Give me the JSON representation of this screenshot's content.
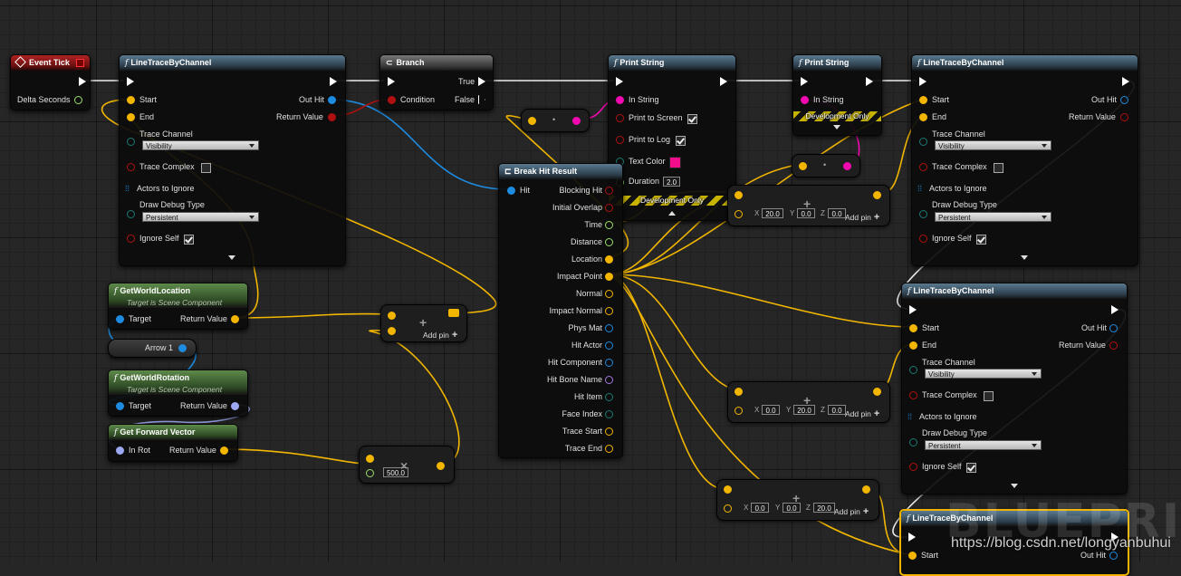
{
  "canvas": {
    "watermark": "BLUEPRINT",
    "url_overlay": "https://blog.csdn.net/longyanbuhui"
  },
  "colors": {
    "exec": "#ffffff",
    "float": "#f2b600",
    "vector": "#f2b600",
    "object": "#1d8be0",
    "string": "#f20ab0",
    "bool": "#b01010",
    "struct": "#1d8be0",
    "rotator": "#9ca8f0",
    "header_function": "#4a6a7f",
    "header_event": "#b02222",
    "header_pure": "#4a7a3a",
    "selection": "#f0b400"
  },
  "event_tick": {
    "title": "Event Tick",
    "delta_seconds": "Delta Seconds"
  },
  "trace1": {
    "title": "LineTraceByChannel",
    "start": "Start",
    "end": "End",
    "out_hit": "Out Hit",
    "return_value": "Return Value",
    "trace_channel": "Trace Channel",
    "trace_channel_value": "Visibility",
    "trace_complex": "Trace Complex",
    "actors_to_ignore": "Actors to Ignore",
    "draw_debug_type": "Draw Debug Type",
    "draw_debug_value": "Persistent",
    "ignore_self": "Ignore Self"
  },
  "branch": {
    "title": "Branch",
    "condition": "Condition",
    "true_label": "True",
    "false_label": "False"
  },
  "print1": {
    "title": "Print String",
    "in_string": "In String",
    "print_to_screen": "Print to Screen",
    "print_to_log": "Print to Log",
    "text_color": "Text Color",
    "duration": "Duration",
    "duration_value": "2.0",
    "dev_only": "Development Only"
  },
  "print2": {
    "title": "Print String",
    "in_string": "In String",
    "dev_only": "Development Only"
  },
  "trace2": {
    "title": "LineTraceByChannel",
    "start": "Start",
    "end": "End",
    "out_hit": "Out Hit",
    "return_value": "Return Value",
    "trace_channel": "Trace Channel",
    "trace_channel_value": "Visibility",
    "trace_complex": "Trace Complex",
    "actors_to_ignore": "Actors to Ignore",
    "draw_debug_type": "Draw Debug Type",
    "draw_debug_value": "Persistent",
    "ignore_self": "Ignore Self"
  },
  "trace3": {
    "title": "LineTraceByChannel",
    "start": "Start",
    "end": "End",
    "out_hit": "Out Hit",
    "return_value": "Return Value",
    "trace_channel": "Trace Channel",
    "trace_channel_value": "Visibility",
    "trace_complex": "Trace Complex",
    "actors_to_ignore": "Actors to Ignore",
    "draw_debug_type": "Draw Debug Type",
    "draw_debug_value": "Persistent",
    "ignore_self": "Ignore Self"
  },
  "trace4": {
    "title": "LineTraceByChannel",
    "start": "Start",
    "out_hit": "Out Hit"
  },
  "break_hit": {
    "title": "Break Hit Result",
    "hit": "Hit",
    "outputs": [
      "Blocking Hit",
      "Initial Overlap",
      "Time",
      "Distance",
      "Location",
      "Impact Point",
      "Normal",
      "Impact Normal",
      "Phys Mat",
      "Hit Actor",
      "Hit Component",
      "Hit Bone Name",
      "Hit Item",
      "Face Index",
      "Trace Start",
      "Trace End"
    ]
  },
  "get_world_location": {
    "title": "GetWorldLocation",
    "subtitle": "Target is Scene Component",
    "target": "Target",
    "return_value": "Return Value"
  },
  "arrow_var": {
    "label": "Arrow 1"
  },
  "get_world_rotation": {
    "title": "GetWorldRotation",
    "subtitle": "Target is Scene Component",
    "target": "Target",
    "return_value": "Return Value"
  },
  "get_forward_vector": {
    "title": "Get Forward Vector",
    "in_rot": "In Rot",
    "return_value": "Return Value"
  },
  "add_pin_label": "Add pin",
  "multiply": {
    "value": "500.0"
  },
  "vec_add1": {
    "x": "20.0",
    "y": "0.0",
    "z": "0.0",
    "x_label": "X",
    "y_label": "Y",
    "z_label": "Z"
  },
  "vec_add2": {
    "x": "0.0",
    "y": "20.0",
    "z": "0.0",
    "x_label": "X",
    "y_label": "Y",
    "z_label": "Z"
  },
  "vec_add3": {
    "x": "0.0",
    "y": "0.0",
    "z": "20.0",
    "x_label": "X",
    "y_label": "Y",
    "z_label": "Z"
  }
}
